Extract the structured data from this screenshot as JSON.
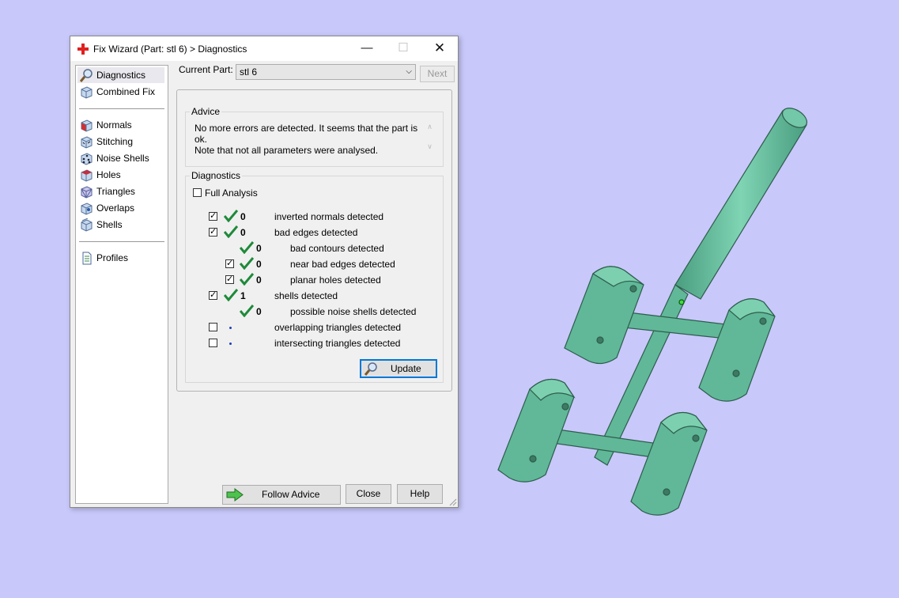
{
  "window": {
    "title": "Fix Wizard (Part: stl 6) > Diagnostics",
    "min_glyph": "—",
    "max_glyph": "☐",
    "close_glyph": "✕"
  },
  "sidebar": {
    "items": [
      {
        "label": "Diagnostics",
        "icon": "magnifier-icon"
      },
      {
        "label": "Combined Fix",
        "icon": "cube-icon"
      },
      {
        "label": "Normals",
        "icon": "cube-red-face-icon"
      },
      {
        "label": "Stitching",
        "icon": "cube-stitch-icon"
      },
      {
        "label": "Noise Shells",
        "icon": "cube-dots-icon"
      },
      {
        "label": "Holes",
        "icon": "cube-hole-icon"
      },
      {
        "label": "Triangles",
        "icon": "cube-triangles-icon"
      },
      {
        "label": "Overlaps",
        "icon": "cube-overlap-icon"
      },
      {
        "label": "Shells",
        "icon": "cube-shells-icon"
      },
      {
        "label": "Profiles",
        "icon": "document-icon"
      }
    ]
  },
  "current_part": {
    "label": "Current Part:",
    "value": "stl 6",
    "arrow": "⌵",
    "next_label": "Next"
  },
  "advice": {
    "title": "Advice",
    "line1": "No more errors are detected. It seems that the part is ok.",
    "line2": "Note that not all parameters were analysed.",
    "scroll_up": "∧",
    "scroll_down": "∨"
  },
  "diagnostics": {
    "title": "Diagnostics",
    "full_analysis_label": "Full Analysis",
    "check_glyph": "✓",
    "rows": [
      {
        "checked": true,
        "status": "ok",
        "count": "0",
        "label": "inverted normals detected"
      },
      {
        "checked": true,
        "status": "ok",
        "count": "0",
        "label": "bad edges detected"
      },
      {
        "status": "ok",
        "count": "0",
        "label": "bad contours detected"
      },
      {
        "checked": true,
        "status": "ok",
        "count": "0",
        "label": "near bad edges detected"
      },
      {
        "checked": true,
        "status": "ok",
        "count": "0",
        "label": "planar holes detected"
      },
      {
        "checked": true,
        "status": "ok",
        "count": "1",
        "label": "shells detected"
      },
      {
        "status": "ok",
        "count": "0",
        "label": "possible noise shells detected"
      },
      {
        "checked": false,
        "status": "pending",
        "label": "overlapping triangles detected"
      },
      {
        "checked": false,
        "status": "pending",
        "label": "intersecting triangles detected"
      }
    ],
    "update_label": "Update"
  },
  "footer": {
    "follow_advice_label": "Follow Advice",
    "close_label": "Close",
    "help_label": "Help"
  },
  "colors": {
    "viewport_bg": "#c8c8fa",
    "model": "#5fb898",
    "check_green": "#1e8a3a",
    "accent_blue": "#0078d7"
  }
}
